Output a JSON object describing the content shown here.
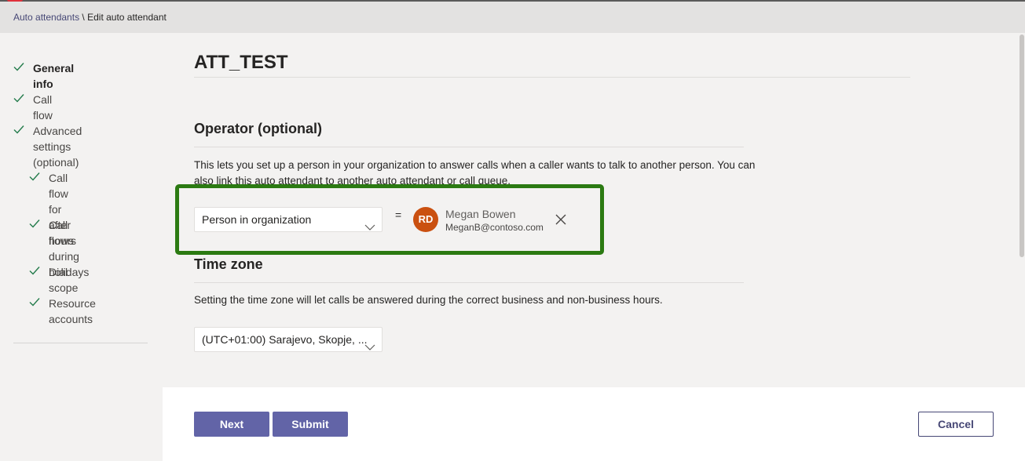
{
  "breadcrumb": {
    "parent": "Auto attendants",
    "separator": " \\ ",
    "current": "Edit auto attendant"
  },
  "sidebar": {
    "steps": [
      {
        "label": "General info",
        "active": true
      },
      {
        "label": "Call flow"
      },
      {
        "label": "Advanced settings\n(optional)"
      },
      {
        "label": "Call flow for\nafter hours"
      },
      {
        "label": "Call flows\nduring holidays"
      },
      {
        "label": "Dial scope"
      },
      {
        "label": "Resource\naccounts"
      }
    ]
  },
  "page": {
    "title": "ATT_TEST"
  },
  "operator": {
    "title": "Operator (optional)",
    "description": "This lets you set up a person in your organization to answer calls when a caller wants to talk to another person. You can also link this auto attendant to another auto attendant or call queue.",
    "type_selected": "Person in organization",
    "equals": "=",
    "person": {
      "initials": "RD",
      "name": "Megan Bowen",
      "email": "MeganB@contoso.com"
    }
  },
  "timezone": {
    "title": "Time zone",
    "description": "Setting the time zone will let calls be answered during the correct business and non-business hours.",
    "selected": "(UTC+01:00) Sarajevo, Skopje, ..."
  },
  "footer": {
    "next_label": "Next",
    "submit_label": "Submit",
    "cancel_label": "Cancel"
  },
  "colors": {
    "accent": "#6264a7",
    "highlight": "#2b7a12",
    "avatar": "#ca5010",
    "check": "#237b4b"
  }
}
